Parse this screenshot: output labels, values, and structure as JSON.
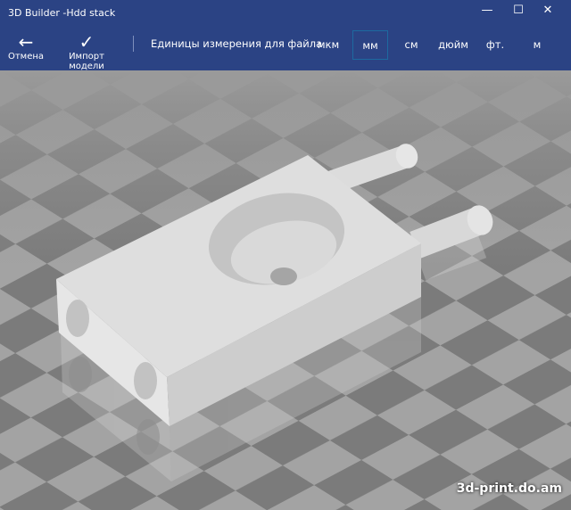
{
  "window": {
    "title": "3D Builder -Hdd stack",
    "minimize_icon": "minimize-icon",
    "maximize_icon": "maximize-icon",
    "close_icon": "close-icon"
  },
  "toolbar": {
    "cancel_label": "Отмена",
    "import_label": "Импорт модели",
    "units_label": "Единицы измерения для файла",
    "units": [
      "мкм",
      "мм",
      "см",
      "дюйм",
      "фт.",
      "м"
    ],
    "selected_unit": "мм"
  },
  "watermark": "3d-print.do.am",
  "colors": {
    "titlebar": "#2b4384",
    "selected_border": "#1d6aa0"
  }
}
